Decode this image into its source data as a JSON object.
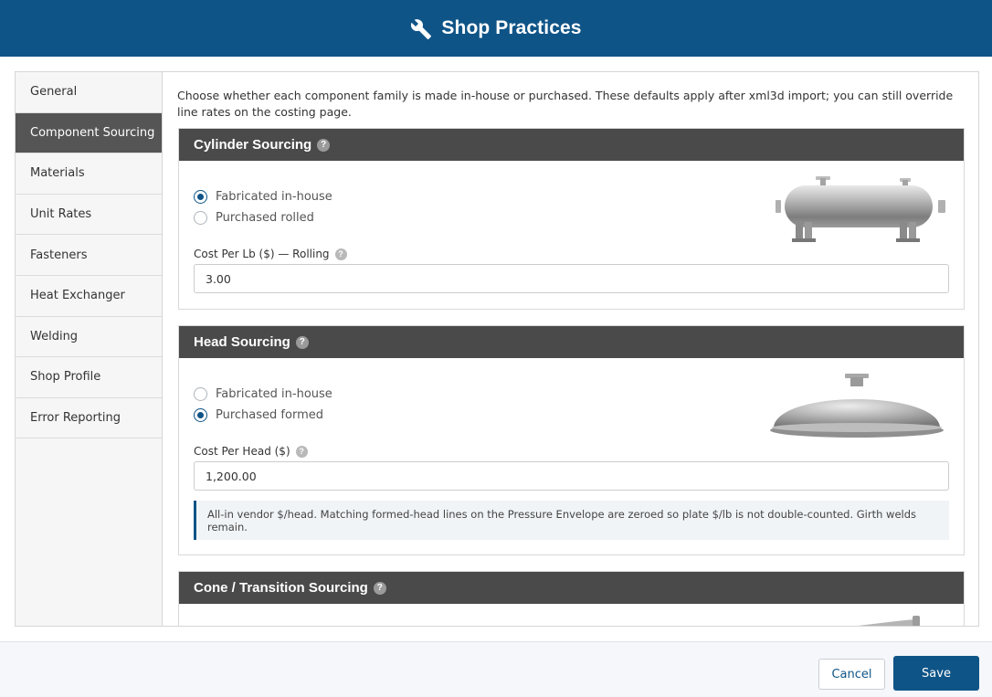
{
  "header": {
    "title": "Shop Practices",
    "icon": "wrench-icon"
  },
  "sidebar": {
    "items": [
      {
        "label": "General",
        "active": false
      },
      {
        "label": "Component Sourcing",
        "active": true
      },
      {
        "label": "Materials",
        "active": false
      },
      {
        "label": "Unit Rates",
        "active": false
      },
      {
        "label": "Fasteners",
        "active": false
      },
      {
        "label": "Heat Exchanger",
        "active": false
      },
      {
        "label": "Welding",
        "active": false
      },
      {
        "label": "Shop Profile",
        "active": false
      },
      {
        "label": "Error Reporting",
        "active": false
      }
    ]
  },
  "main": {
    "intro": "Choose whether each component family is made in-house or purchased. These defaults apply after xml3d import; you can still override line rates on the costing page.",
    "cylinder": {
      "title": "Cylinder Sourcing",
      "options": [
        {
          "label": "Fabricated in-house",
          "checked": true
        },
        {
          "label": "Purchased rolled",
          "checked": false
        }
      ],
      "field_label": "Cost Per Lb ($) — Rolling",
      "field_value": "3.00"
    },
    "head": {
      "title": "Head Sourcing",
      "options": [
        {
          "label": "Fabricated in-house",
          "checked": false
        },
        {
          "label": "Purchased formed",
          "checked": true
        }
      ],
      "field_label": "Cost Per Head ($)",
      "field_value": "1,200.00",
      "note": "All-in vendor $/head. Matching formed-head lines on the Pressure Envelope are zeroed so plate $/lb is not double-counted. Girth welds remain."
    },
    "cone": {
      "title": "Cone / Transition Sourcing"
    },
    "help_glyph": "?"
  },
  "footer": {
    "cancel_label": "Cancel",
    "save_label": "Save"
  },
  "colors": {
    "primary": "#0f5487",
    "card_header": "#4a4a4a",
    "active_nav": "#555555"
  }
}
